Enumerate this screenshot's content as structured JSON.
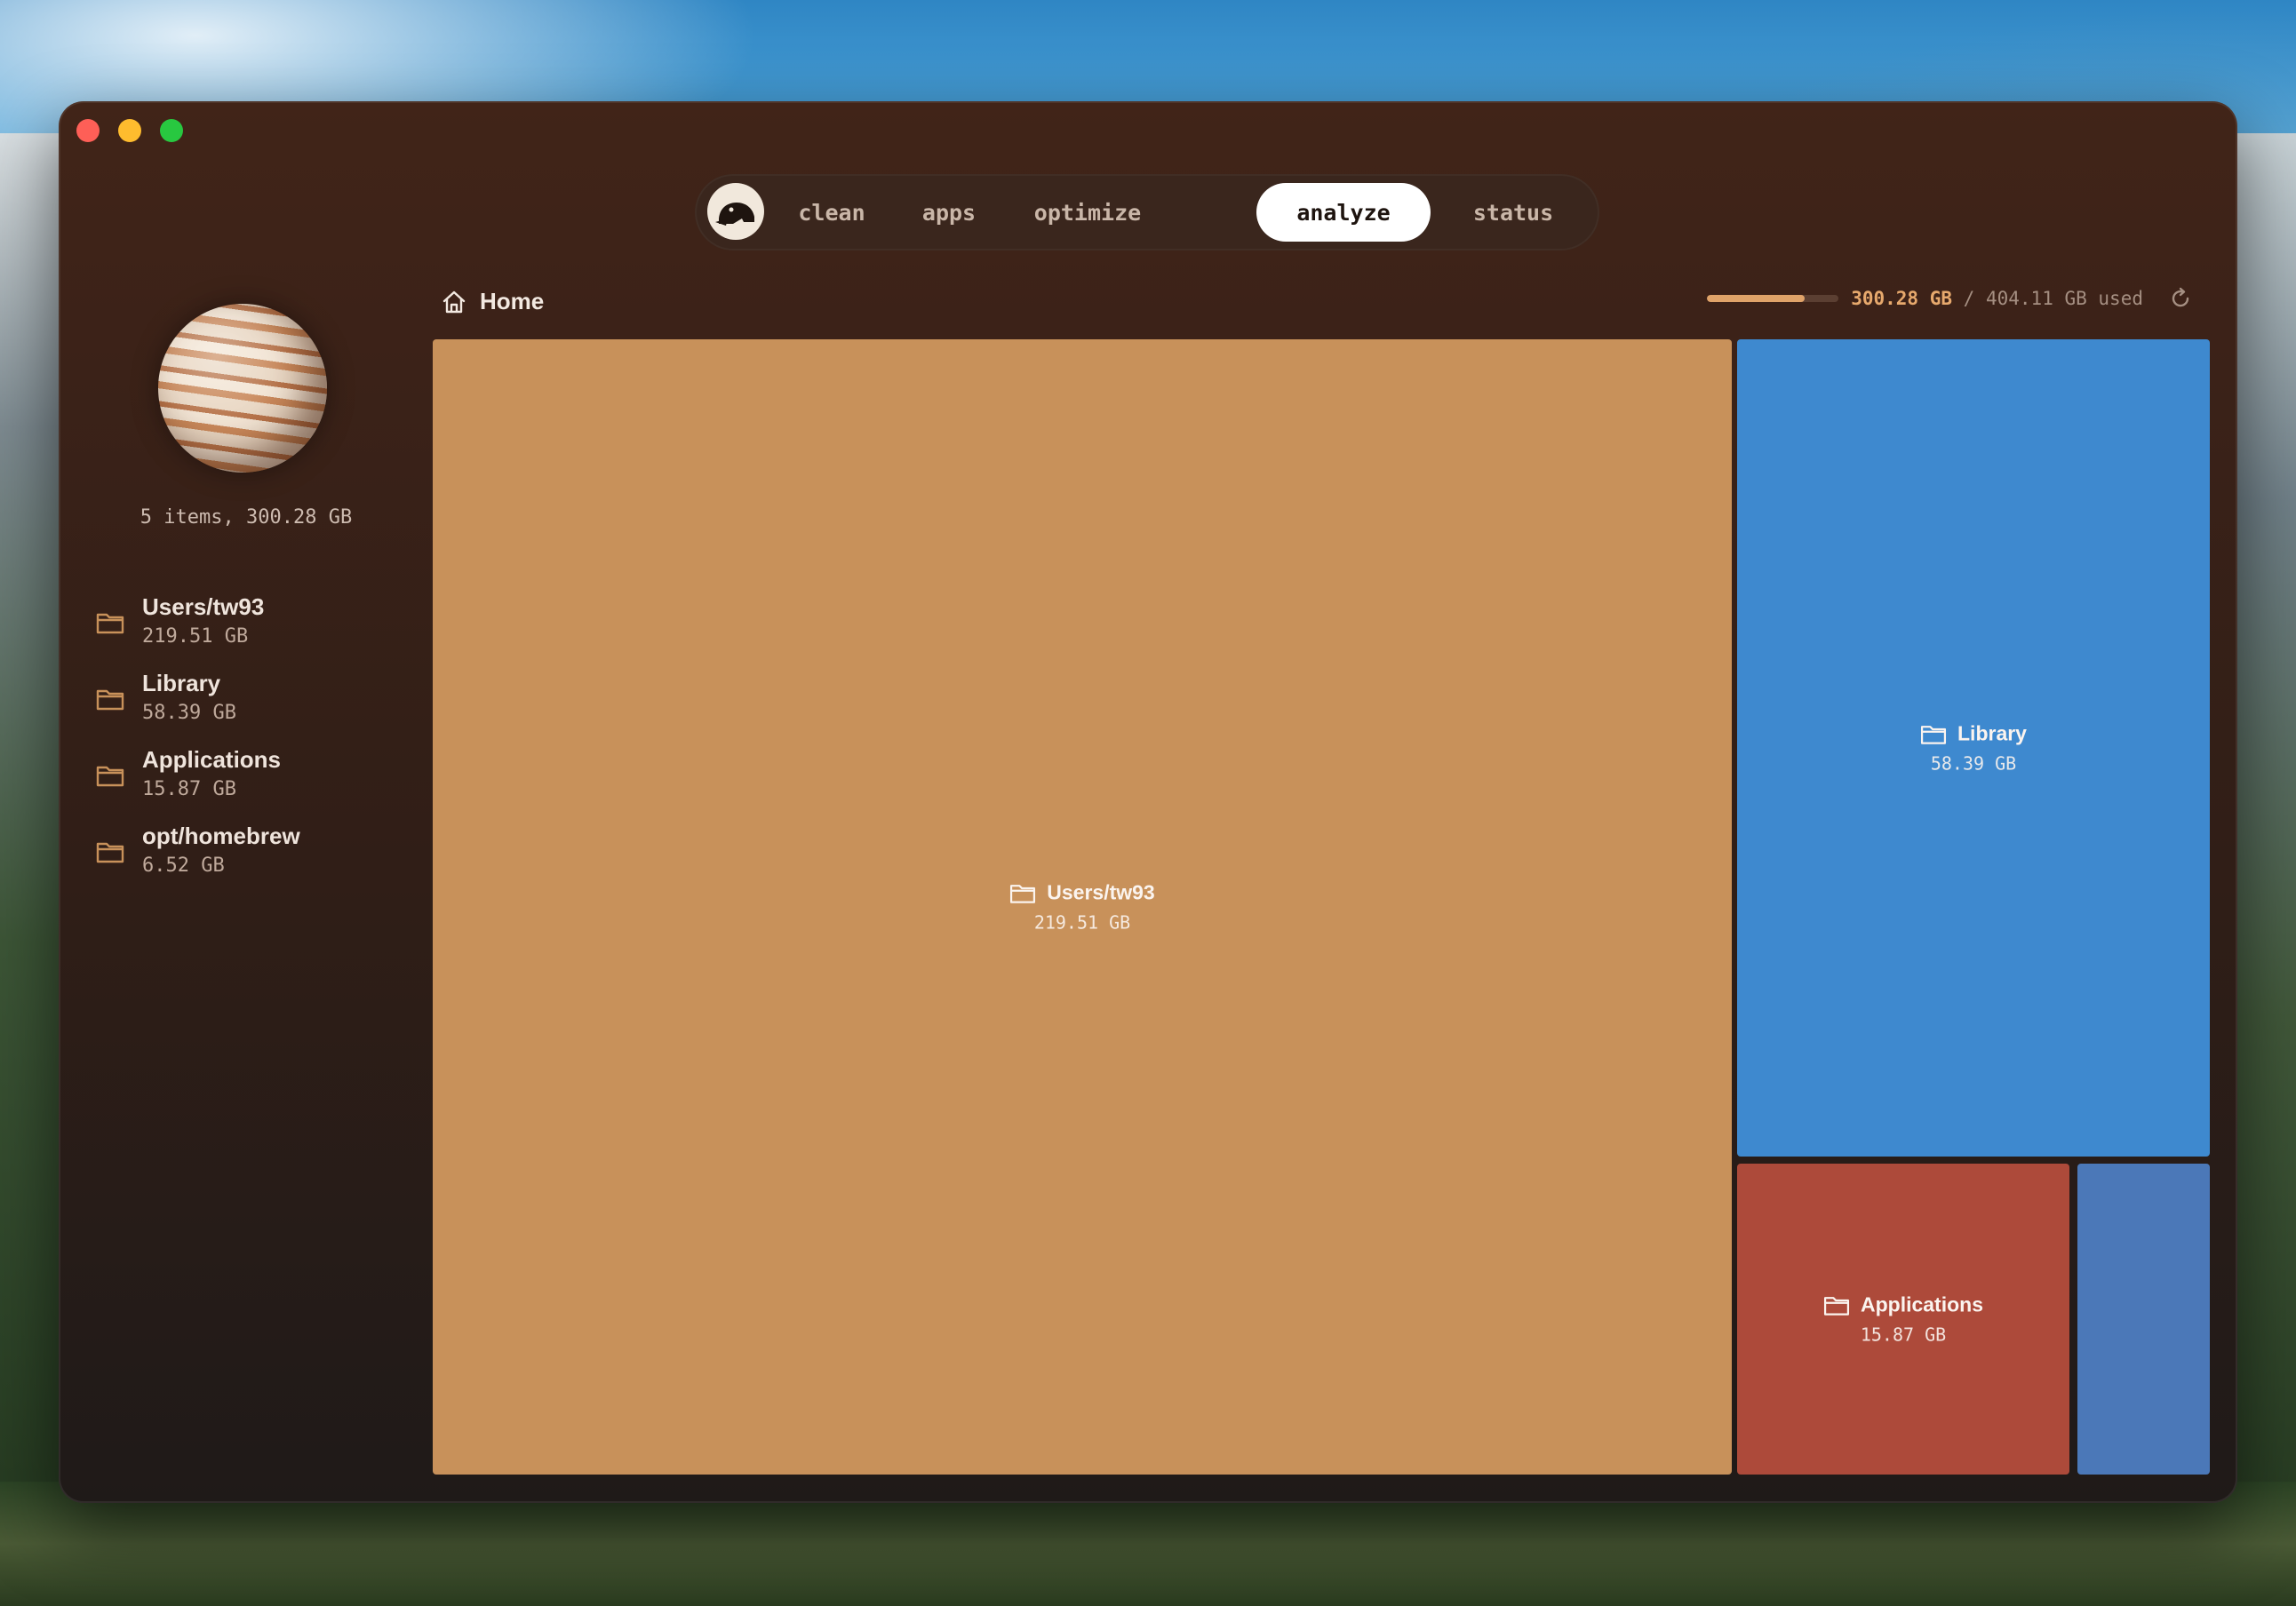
{
  "nav": {
    "logo_icon": "beaver-logo-icon",
    "tabs": [
      {
        "label": "clean",
        "active": false
      },
      {
        "label": "apps",
        "active": false
      },
      {
        "label": "optimize",
        "active": false
      },
      {
        "label": "analyze",
        "active": true
      },
      {
        "label": "status",
        "active": false
      }
    ]
  },
  "sidebar": {
    "summary": "5 items, 300.28 GB",
    "items": [
      {
        "name": "Users/tw93",
        "size": "219.51 GB"
      },
      {
        "name": "Library",
        "size": "58.39 GB"
      },
      {
        "name": "Applications",
        "size": "15.87 GB"
      },
      {
        "name": "opt/homebrew",
        "size": "6.52 GB"
      }
    ]
  },
  "breadcrumb": {
    "label": "Home",
    "icon": "home-icon"
  },
  "disk": {
    "used": "300.28 GB",
    "separator": "/",
    "total": "404.11 GB used",
    "fraction": 0.743
  },
  "treemap": [
    {
      "name": "Users/tw93",
      "size": "219.51 GB",
      "color": "#c8915a"
    },
    {
      "name": "Library",
      "size": "58.39 GB",
      "color": "#3e89cf"
    },
    {
      "name": "Applications",
      "size": "15.87 GB",
      "color": "#ad4a3a"
    },
    {
      "name": "",
      "size": "",
      "color": "#4b78b8"
    }
  ],
  "colors": {
    "accent": "#e0a369",
    "window_bg": "#3a2118",
    "folder_icon": "#c8915a"
  }
}
